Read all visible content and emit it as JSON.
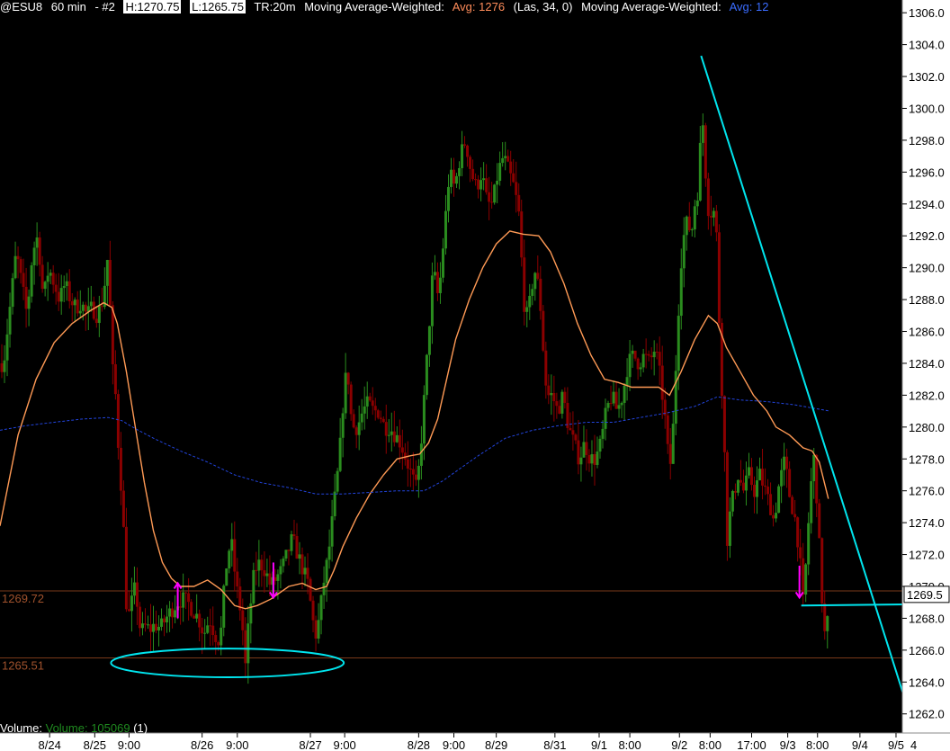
{
  "header": {
    "symbol": "@ESU8",
    "interval": "60 min",
    "chart_num": "- #2",
    "high": "H:1270.75",
    "low": "L:1265.75",
    "tr": "TR:20m",
    "ma1_label": "Moving Average-Weighted:",
    "ma1_avg": "Avg: 1276",
    "ma1_params": "(Las, 34, 0)",
    "ma2_label": "Moving Average-Weighted:",
    "ma2_avg": "Avg: 12"
  },
  "volume_label": {
    "name": "Volume:",
    "value": "Volume: 105069",
    "suffix": "(1)"
  },
  "colors": {
    "background": "#000000",
    "up_bar": "#2a8c1e",
    "down_bar": "#8b0000",
    "ma_fast": "#ff9a55",
    "ma_slow": "#2244dd",
    "trendline": "#00e5ee",
    "signal_arrow": "#ff00ff",
    "level_line": "#7a3a1a",
    "axis_panel": "#ffffff"
  },
  "chart_data": {
    "type": "candlestick",
    "y_axis": {
      "ticks": [
        "1262.0",
        "1264.0",
        "1266.0",
        "1268.0",
        "1270.0",
        "1272.0",
        "1274.0",
        "1276.0",
        "1278.0",
        "1280.0",
        "1282.0",
        "1284.0",
        "1286.0",
        "1288.0",
        "1290.0",
        "1292.0",
        "1294.0",
        "1296.0",
        "1298.0",
        "1300.0",
        "1302.0",
        "1304.0",
        "1306.0"
      ],
      "range": [
        1260.8,
        1306.8
      ],
      "current_price": "1269.5"
    },
    "x_axis": {
      "range": [
        0,
        1000
      ],
      "ticks": [
        {
          "x": 55,
          "label": "8/24"
        },
        {
          "x": 105,
          "label": "8/25"
        },
        {
          "x": 143,
          "label": "9:00"
        },
        {
          "x": 224,
          "label": "8/26"
        },
        {
          "x": 263,
          "label": "9:00"
        },
        {
          "x": 344,
          "label": "8/27"
        },
        {
          "x": 382,
          "label": "9:00"
        },
        {
          "x": 464,
          "label": "8/28"
        },
        {
          "x": 503,
          "label": "9:00"
        },
        {
          "x": 550,
          "label": "8/29"
        },
        {
          "x": 615,
          "label": "8/31"
        },
        {
          "x": 664,
          "label": "9/1"
        },
        {
          "x": 698,
          "label": "8:00"
        },
        {
          "x": 753,
          "label": "9/2"
        },
        {
          "x": 787,
          "label": "8:00"
        },
        {
          "x": 833,
          "label": "17:00"
        },
        {
          "x": 873,
          "label": "9/3"
        },
        {
          "x": 906,
          "label": "8:00"
        },
        {
          "x": 953,
          "label": "9/4"
        },
        {
          "x": 993,
          "label": "9/5"
        }
      ],
      "trailing_label": "4"
    },
    "price_levels": [
      {
        "value": 1269.72,
        "label": "1269.72"
      },
      {
        "value": 1265.51,
        "label": "1265.51"
      }
    ],
    "close_path": [
      [
        4,
        1284
      ],
      [
        12,
        1288
      ],
      [
        18,
        1291
      ],
      [
        24,
        1289
      ],
      [
        30,
        1287
      ],
      [
        36,
        1291
      ],
      [
        42,
        1292
      ],
      [
        48,
        1288
      ],
      [
        54,
        1290
      ],
      [
        60,
        1289
      ],
      [
        66,
        1288
      ],
      [
        72,
        1289
      ],
      [
        78,
        1288
      ],
      [
        84,
        1287.5
      ],
      [
        90,
        1287.8
      ],
      [
        96,
        1287
      ],
      [
        102,
        1287.5
      ],
      [
        108,
        1287
      ],
      [
        114,
        1288
      ],
      [
        120,
        1291
      ],
      [
        124,
        1284
      ],
      [
        128,
        1282
      ],
      [
        132,
        1278
      ],
      [
        136,
        1275
      ],
      [
        140,
        1269
      ],
      [
        144,
        1268
      ],
      [
        148,
        1270
      ],
      [
        152,
        1269
      ],
      [
        156,
        1267
      ],
      [
        160,
        1267.5
      ],
      [
        166,
        1267.3
      ],
      [
        172,
        1267.6
      ],
      [
        178,
        1267.4
      ],
      [
        184,
        1268
      ],
      [
        190,
        1268.5
      ],
      [
        196,
        1269
      ],
      [
        202,
        1269.2
      ],
      [
        208,
        1269
      ],
      [
        214,
        1268.5
      ],
      [
        220,
        1268
      ],
      [
        226,
        1267
      ],
      [
        232,
        1268
      ],
      [
        238,
        1267
      ],
      [
        244,
        1266.5
      ],
      [
        250,
        1271
      ],
      [
        256,
        1273
      ],
      [
        262,
        1270
      ],
      [
        268,
        1268
      ],
      [
        272,
        1265
      ],
      [
        276,
        1268
      ],
      [
        282,
        1271
      ],
      [
        288,
        1271.5
      ],
      [
        294,
        1271
      ],
      [
        300,
        1270
      ],
      [
        306,
        1270.5
      ],
      [
        312,
        1271
      ],
      [
        318,
        1272
      ],
      [
        324,
        1273
      ],
      [
        330,
        1272
      ],
      [
        336,
        1271
      ],
      [
        342,
        1270
      ],
      [
        346,
        1268
      ],
      [
        350,
        1267
      ],
      [
        354,
        1268
      ],
      [
        358,
        1270
      ],
      [
        364,
        1272
      ],
      [
        370,
        1275
      ],
      [
        376,
        1278
      ],
      [
        382,
        1283
      ],
      [
        386,
        1283
      ],
      [
        390,
        1280
      ],
      [
        396,
        1280
      ],
      [
        402,
        1281
      ],
      [
        408,
        1281.5
      ],
      [
        414,
        1281
      ],
      [
        420,
        1281
      ],
      [
        426,
        1280
      ],
      [
        432,
        1280
      ],
      [
        438,
        1279.5
      ],
      [
        444,
        1279
      ],
      [
        450,
        1278
      ],
      [
        456,
        1277
      ],
      [
        462,
        1276
      ],
      [
        468,
        1280
      ],
      [
        474,
        1285
      ],
      [
        480,
        1290
      ],
      [
        486,
        1288
      ],
      [
        492,
        1292
      ],
      [
        498,
        1296
      ],
      [
        504,
        1295
      ],
      [
        510,
        1297
      ],
      [
        516,
        1298
      ],
      [
        522,
        1296
      ],
      [
        528,
        1295
      ],
      [
        534,
        1296
      ],
      [
        540,
        1294
      ],
      [
        546,
        1294
      ],
      [
        552,
        1296
      ],
      [
        558,
        1297
      ],
      [
        564,
        1296
      ],
      [
        570,
        1295
      ],
      [
        576,
        1293
      ],
      [
        580,
        1288
      ],
      [
        584,
        1287
      ],
      [
        588,
        1288
      ],
      [
        592,
        1290
      ],
      [
        596,
        1289
      ],
      [
        600,
        1287
      ],
      [
        604,
        1283
      ],
      [
        608,
        1282
      ],
      [
        612,
        1282
      ],
      [
        618,
        1281
      ],
      [
        624,
        1282
      ],
      [
        630,
        1280
      ],
      [
        636,
        1279
      ],
      [
        642,
        1278
      ],
      [
        648,
        1279
      ],
      [
        654,
        1278
      ],
      [
        660,
        1278
      ],
      [
        666,
        1279
      ],
      [
        672,
        1281
      ],
      [
        678,
        1282
      ],
      [
        684,
        1281
      ],
      [
        690,
        1282
      ],
      [
        696,
        1284
      ],
      [
        702,
        1284.5
      ],
      [
        708,
        1284
      ],
      [
        714,
        1284.5
      ],
      [
        720,
        1284
      ],
      [
        726,
        1285
      ],
      [
        732,
        1283
      ],
      [
        738,
        1280
      ],
      [
        742,
        1277
      ],
      [
        746,
        1280
      ],
      [
        750,
        1285
      ],
      [
        754,
        1290
      ],
      [
        758,
        1292
      ],
      [
        762,
        1293
      ],
      [
        766,
        1292
      ],
      [
        770,
        1294
      ],
      [
        774,
        1295
      ],
      [
        778,
        1300
      ],
      [
        782,
        1296
      ],
      [
        786,
        1293
      ],
      [
        790,
        1294
      ],
      [
        794,
        1292
      ],
      [
        798,
        1285
      ],
      [
        802,
        1280
      ],
      [
        806,
        1273
      ],
      [
        810,
        1275
      ],
      [
        814,
        1276
      ],
      [
        818,
        1277
      ],
      [
        824,
        1276
      ],
      [
        830,
        1277
      ],
      [
        836,
        1276
      ],
      [
        842,
        1277
      ],
      [
        848,
        1276
      ],
      [
        854,
        1275
      ],
      [
        858,
        1274
      ],
      [
        862,
        1276
      ],
      [
        866,
        1277
      ],
      [
        870,
        1278
      ],
      [
        874,
        1276
      ],
      [
        878,
        1275
      ],
      [
        882,
        1274
      ],
      [
        886,
        1272
      ],
      [
        890,
        1269
      ],
      [
        894,
        1272
      ],
      [
        898,
        1276
      ],
      [
        902,
        1278
      ],
      [
        906,
        1275
      ],
      [
        910,
        1270
      ],
      [
        914,
        1267
      ],
      [
        918,
        1268
      ]
    ],
    "series": [
      {
        "name": "Moving Average-Weighted: Avg: 1276 (Las, 34, 0)",
        "points": [
          [
            0,
            1273.8
          ],
          [
            20,
            1279.5
          ],
          [
            40,
            1283
          ],
          [
            60,
            1285.3
          ],
          [
            80,
            1286.5
          ],
          [
            100,
            1287.3
          ],
          [
            115,
            1287.8
          ],
          [
            124,
            1287.5
          ],
          [
            130,
            1286.5
          ],
          [
            140,
            1283.5
          ],
          [
            150,
            1280
          ],
          [
            160,
            1276.5
          ],
          [
            170,
            1273.5
          ],
          [
            180,
            1271.5
          ],
          [
            190,
            1270.5
          ],
          [
            200,
            1270
          ],
          [
            215,
            1270
          ],
          [
            230,
            1270.4
          ],
          [
            245,
            1269.8
          ],
          [
            260,
            1268.8
          ],
          [
            272,
            1268.6
          ],
          [
            285,
            1268.8
          ],
          [
            300,
            1269.2
          ],
          [
            320,
            1270
          ],
          [
            335,
            1270.2
          ],
          [
            350,
            1269.8
          ],
          [
            362,
            1270
          ],
          [
            370,
            1271
          ],
          [
            380,
            1272.5
          ],
          [
            395,
            1274.3
          ],
          [
            410,
            1275.8
          ],
          [
            425,
            1277
          ],
          [
            440,
            1278
          ],
          [
            455,
            1278.2
          ],
          [
            465,
            1278.3
          ],
          [
            475,
            1279
          ],
          [
            485,
            1280.5
          ],
          [
            495,
            1283
          ],
          [
            505,
            1285.5
          ],
          [
            520,
            1288
          ],
          [
            535,
            1290
          ],
          [
            550,
            1291.5
          ],
          [
            565,
            1292.3
          ],
          [
            580,
            1292.1
          ],
          [
            597,
            1292
          ],
          [
            610,
            1291
          ],
          [
            625,
            1289
          ],
          [
            640,
            1286.5
          ],
          [
            655,
            1284.5
          ],
          [
            670,
            1283
          ],
          [
            685,
            1282.8
          ],
          [
            700,
            1282.5
          ],
          [
            715,
            1282.5
          ],
          [
            730,
            1282.5
          ],
          [
            742,
            1282
          ],
          [
            755,
            1283.5
          ],
          [
            770,
            1285.5
          ],
          [
            785,
            1287
          ],
          [
            795,
            1286.5
          ],
          [
            805,
            1285
          ],
          [
            820,
            1283.5
          ],
          [
            835,
            1282
          ],
          [
            850,
            1281
          ],
          [
            860,
            1280
          ],
          [
            875,
            1279.5
          ],
          [
            890,
            1278.7
          ],
          [
            900,
            1278.5
          ],
          [
            908,
            1277.8
          ],
          [
            918,
            1275.5
          ]
        ]
      },
      {
        "name": "Moving Average-Weighted: Avg: 12",
        "points": [
          [
            0,
            1279.8
          ],
          [
            30,
            1280.1
          ],
          [
            60,
            1280.3
          ],
          [
            90,
            1280.5
          ],
          [
            120,
            1280.6
          ],
          [
            135,
            1280.4
          ],
          [
            150,
            1279.9
          ],
          [
            170,
            1279.3
          ],
          [
            200,
            1278.5
          ],
          [
            230,
            1277.8
          ],
          [
            260,
            1277
          ],
          [
            290,
            1276.5
          ],
          [
            320,
            1276.2
          ],
          [
            350,
            1275.8
          ],
          [
            380,
            1275.8
          ],
          [
            410,
            1275.9
          ],
          [
            440,
            1276
          ],
          [
            470,
            1276
          ],
          [
            490,
            1276.6
          ],
          [
            510,
            1277.4
          ],
          [
            530,
            1278.2
          ],
          [
            560,
            1279.3
          ],
          [
            590,
            1279.8
          ],
          [
            620,
            1280.1
          ],
          [
            650,
            1280.3
          ],
          [
            680,
            1280.3
          ],
          [
            710,
            1280.6
          ],
          [
            740,
            1280.9
          ],
          [
            770,
            1281.3
          ],
          [
            795,
            1281.9
          ],
          [
            820,
            1281.7
          ],
          [
            850,
            1281.6
          ],
          [
            880,
            1281.4
          ],
          [
            900,
            1281.2
          ],
          [
            920,
            1281
          ]
        ]
      }
    ],
    "trendlines": [
      {
        "x1": 777,
        "y1": 1303.3,
        "x2": 1003,
        "y2": 1262.9
      },
      {
        "x1": 888,
        "y1": 1268.8,
        "x2": 1056,
        "y2": 1268.9
      }
    ],
    "ellipse": {
      "cx": 252,
      "cy": 1265.2,
      "rx": 129,
      "ry": 0.9
    },
    "arrows": [
      {
        "x": 197,
        "from": 1268,
        "to": 1270.2,
        "dir": "up"
      },
      {
        "x": 303,
        "from": 1271.5,
        "to": 1269.3,
        "dir": "down"
      },
      {
        "x": 886,
        "from": 1271.3,
        "to": 1269.3,
        "dir": "down"
      }
    ]
  }
}
